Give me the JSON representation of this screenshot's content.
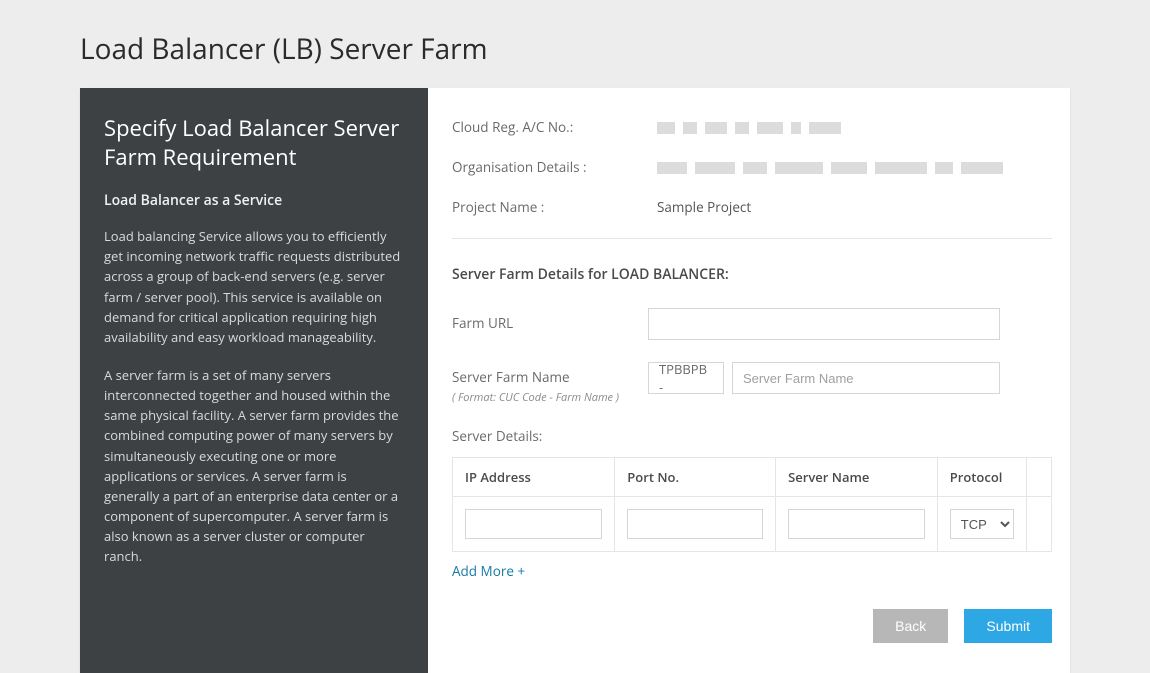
{
  "page": {
    "title": "Load Balancer (LB) Server Farm"
  },
  "sidebar": {
    "heading": "Specify Load Balancer Server Farm Requirement",
    "subheading": "Load Balancer as a Service",
    "para1": "Load balancing Service allows you to efficiently get incoming network traffic requests distributed across a group of back-end servers (e.g. server farm / server pool). This service is available on demand for critical application requiring high availability and easy workload manageability.",
    "para2": "A server farm is a set of many servers interconnected together and housed within the same physical facility. A server farm provides the combined computing power of many servers by simultaneously executing one or more applications or services. A server farm is generally a part of an enterprise data center or a component of supercomputer. A server farm is also known as a server cluster or computer ranch."
  },
  "info": {
    "cloud_reg_label": "Cloud Reg. A/C No.:",
    "cloud_reg_value": "",
    "org_label": "Organisation Details :",
    "org_value": "",
    "project_label": "Project Name :",
    "project_value": "Sample Project"
  },
  "form": {
    "section_title": "Server Farm Details for LOAD BALANCER:",
    "farm_url_label": "Farm URL",
    "farm_url_value": "",
    "farm_name_label": "Server Farm Name",
    "farm_name_hint": "( Format: CUC Code - Farm Name )",
    "farm_name_prefix": "TPBBPB -",
    "farm_name_placeholder": "Server Farm Name",
    "farm_name_value": "",
    "server_details_label": "Server Details:",
    "table": {
      "headers": {
        "ip": "IP Address",
        "port": "Port No.",
        "server": "Server Name",
        "protocol": "Protocol"
      },
      "row": {
        "ip": "",
        "port": "",
        "server": "",
        "protocol": "TCP"
      },
      "protocol_options": [
        "TCP"
      ]
    },
    "add_more": "Add More +"
  },
  "actions": {
    "back": "Back",
    "submit": "Submit"
  }
}
